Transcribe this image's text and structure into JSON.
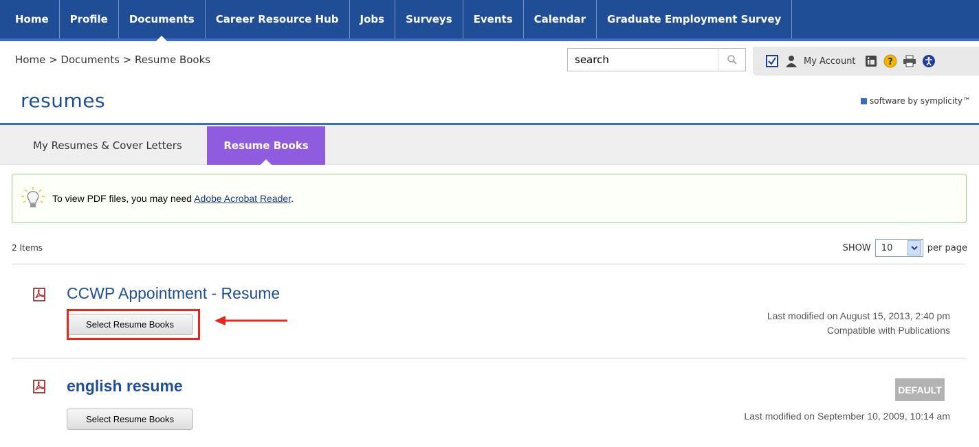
{
  "nav": {
    "items": [
      {
        "label": "Home"
      },
      {
        "label": "Profile"
      },
      {
        "label": "Documents"
      },
      {
        "label": "Career Resource Hub"
      },
      {
        "label": "Jobs"
      },
      {
        "label": "Surveys"
      },
      {
        "label": "Events"
      },
      {
        "label": "Calendar"
      },
      {
        "label": "Graduate Employment Survey"
      }
    ],
    "active": "Documents"
  },
  "breadcrumb": "Home > Documents > Resume Books",
  "search": {
    "value": "search"
  },
  "account": {
    "label": "My Account",
    "icons": [
      "checkbox-icon",
      "user-icon",
      "linkedin-icon",
      "help-icon",
      "print-icon",
      "accessibility-icon"
    ]
  },
  "page": {
    "title": "resumes",
    "vendor": "software by symplicity™"
  },
  "tabs": [
    {
      "label": "My Resumes & Cover Letters"
    },
    {
      "label": "Resume Books"
    }
  ],
  "notice": {
    "prefix": "To view PDF files, you may need ",
    "link": "Adobe Acrobat Reader",
    "suffix": "."
  },
  "list": {
    "count": "2 Items",
    "show_label": "SHOW",
    "per_page": "10",
    "per_page_label": "per page"
  },
  "resumes": [
    {
      "title": "CCWP Appointment - Resume",
      "button": "Select Resume Books",
      "modified": "Last modified on August 15, 2013, 2:40 pm",
      "compat": "Compatible with Publications"
    },
    {
      "title": "english resume",
      "button": "Select Resume Books",
      "badge": "DEFAULT",
      "modified": "Last modified on September 10, 2009, 10:14 am"
    }
  ],
  "colors": {
    "nav_bg": "#1f4e96",
    "tab_active": "#8f5ce0",
    "highlight": "#e8281c",
    "notice_border": "#8ee07a"
  }
}
